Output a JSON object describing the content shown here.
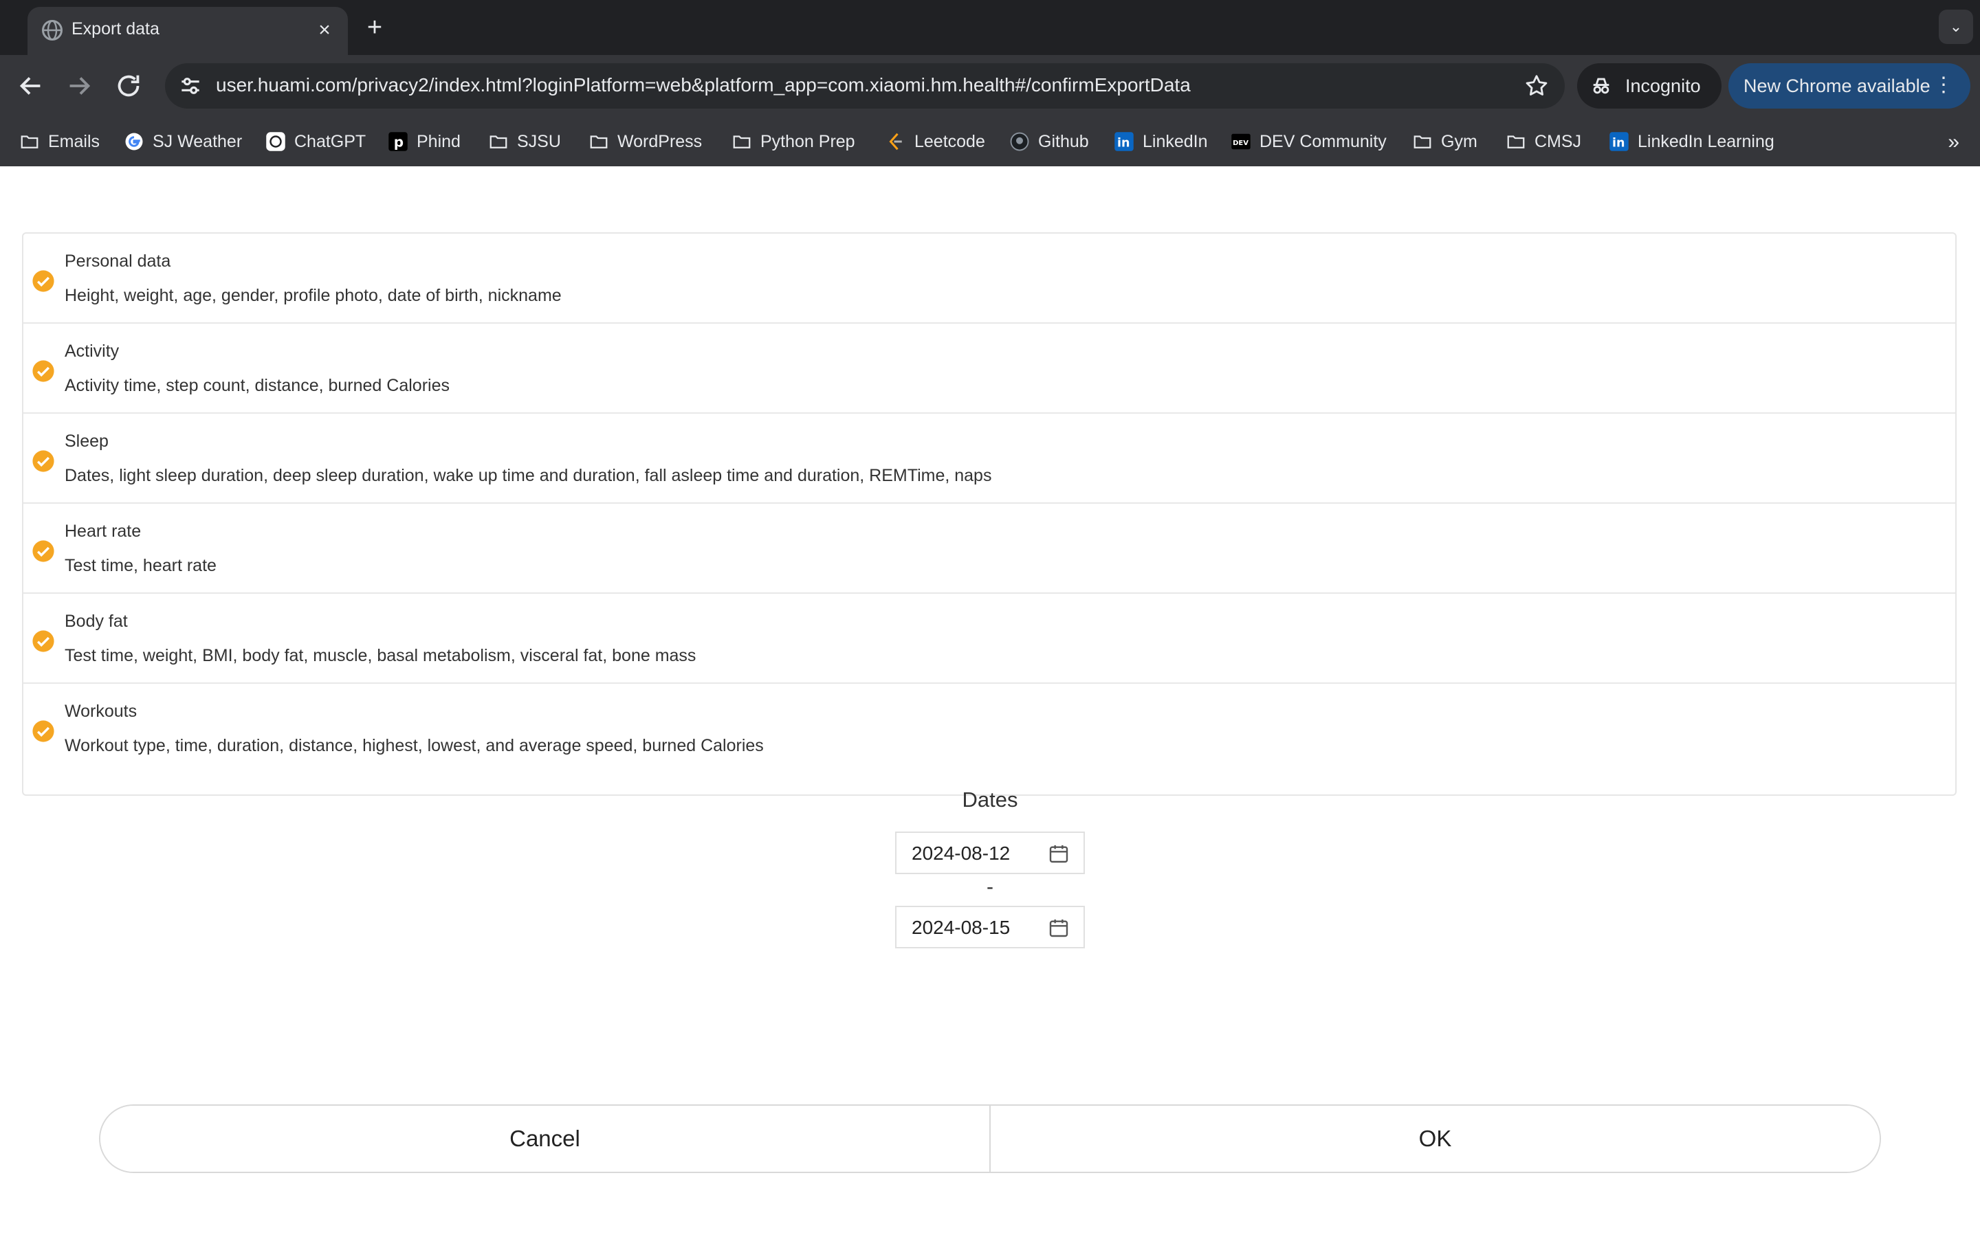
{
  "browser": {
    "tab": {
      "title": "Export data",
      "icon": "globe-icon",
      "close_icon": "close-icon"
    },
    "new_tab_icon": "plus-icon",
    "tab_list_icon": "chevron-down-icon",
    "nav": {
      "back_icon": "back-arrow-icon",
      "forward_icon": "forward-arrow-icon",
      "reload_icon": "reload-icon"
    },
    "address_bar": {
      "url": "user.huami.com/privacy2/index.html?loginPlatform=web&platform_app=com.xiaomi.hm.health#/confirmExportData",
      "site_info_icon": "tune-icon",
      "bookmark_icon": "star-icon"
    },
    "incognito_label": "Incognito",
    "update_label": "New Chrome available",
    "bookmarks": [
      {
        "label": "Emails",
        "icon": "folder-icon"
      },
      {
        "label": "SJ Weather",
        "icon": "google-icon"
      },
      {
        "label": "ChatGPT",
        "icon": "chatgpt-icon"
      },
      {
        "label": "Phind",
        "icon": "phind-icon"
      },
      {
        "label": "SJSU",
        "icon": "folder-icon"
      },
      {
        "label": "WordPress",
        "icon": "folder-icon"
      },
      {
        "label": "Python Prep",
        "icon": "folder-icon"
      },
      {
        "label": "Leetcode",
        "icon": "leetcode-icon"
      },
      {
        "label": "Github",
        "icon": "github-icon"
      },
      {
        "label": "LinkedIn",
        "icon": "linkedin-icon"
      },
      {
        "label": "DEV Community",
        "icon": "dev-icon"
      },
      {
        "label": "Gym",
        "icon": "folder-icon"
      },
      {
        "label": "CMSJ",
        "icon": "folder-icon"
      },
      {
        "label": "LinkedIn Learning",
        "icon": "linkedin-icon"
      }
    ],
    "bookmarks_more_icon": "double-chevron-right-icon"
  },
  "export": {
    "accent_color": "#f5a623",
    "categories": [
      {
        "title": "Personal data",
        "description": "Height, weight, age, gender, profile photo, date of birth, nickname",
        "checked": true
      },
      {
        "title": "Activity",
        "description": "Activity time, step count, distance, burned Calories",
        "checked": true
      },
      {
        "title": "Sleep",
        "description": "Dates, light sleep duration, deep sleep duration, wake up time and duration, fall asleep time and duration, REMTime, naps",
        "checked": true
      },
      {
        "title": "Heart rate",
        "description": "Test time, heart rate",
        "checked": true
      },
      {
        "title": "Body fat",
        "description": "Test time, weight, BMI, body fat, muscle, basal metabolism, visceral fat, bone mass",
        "checked": true
      },
      {
        "title": "Workouts",
        "description": "Workout type, time, duration, distance, highest, lowest, and average speed, burned Calories",
        "checked": true
      }
    ],
    "dates": {
      "title": "Dates",
      "start": "2024-08-12",
      "separator": "-",
      "end": "2024-08-15",
      "icon": "calendar-icon"
    },
    "actions": {
      "cancel_label": "Cancel",
      "ok_label": "OK"
    }
  }
}
